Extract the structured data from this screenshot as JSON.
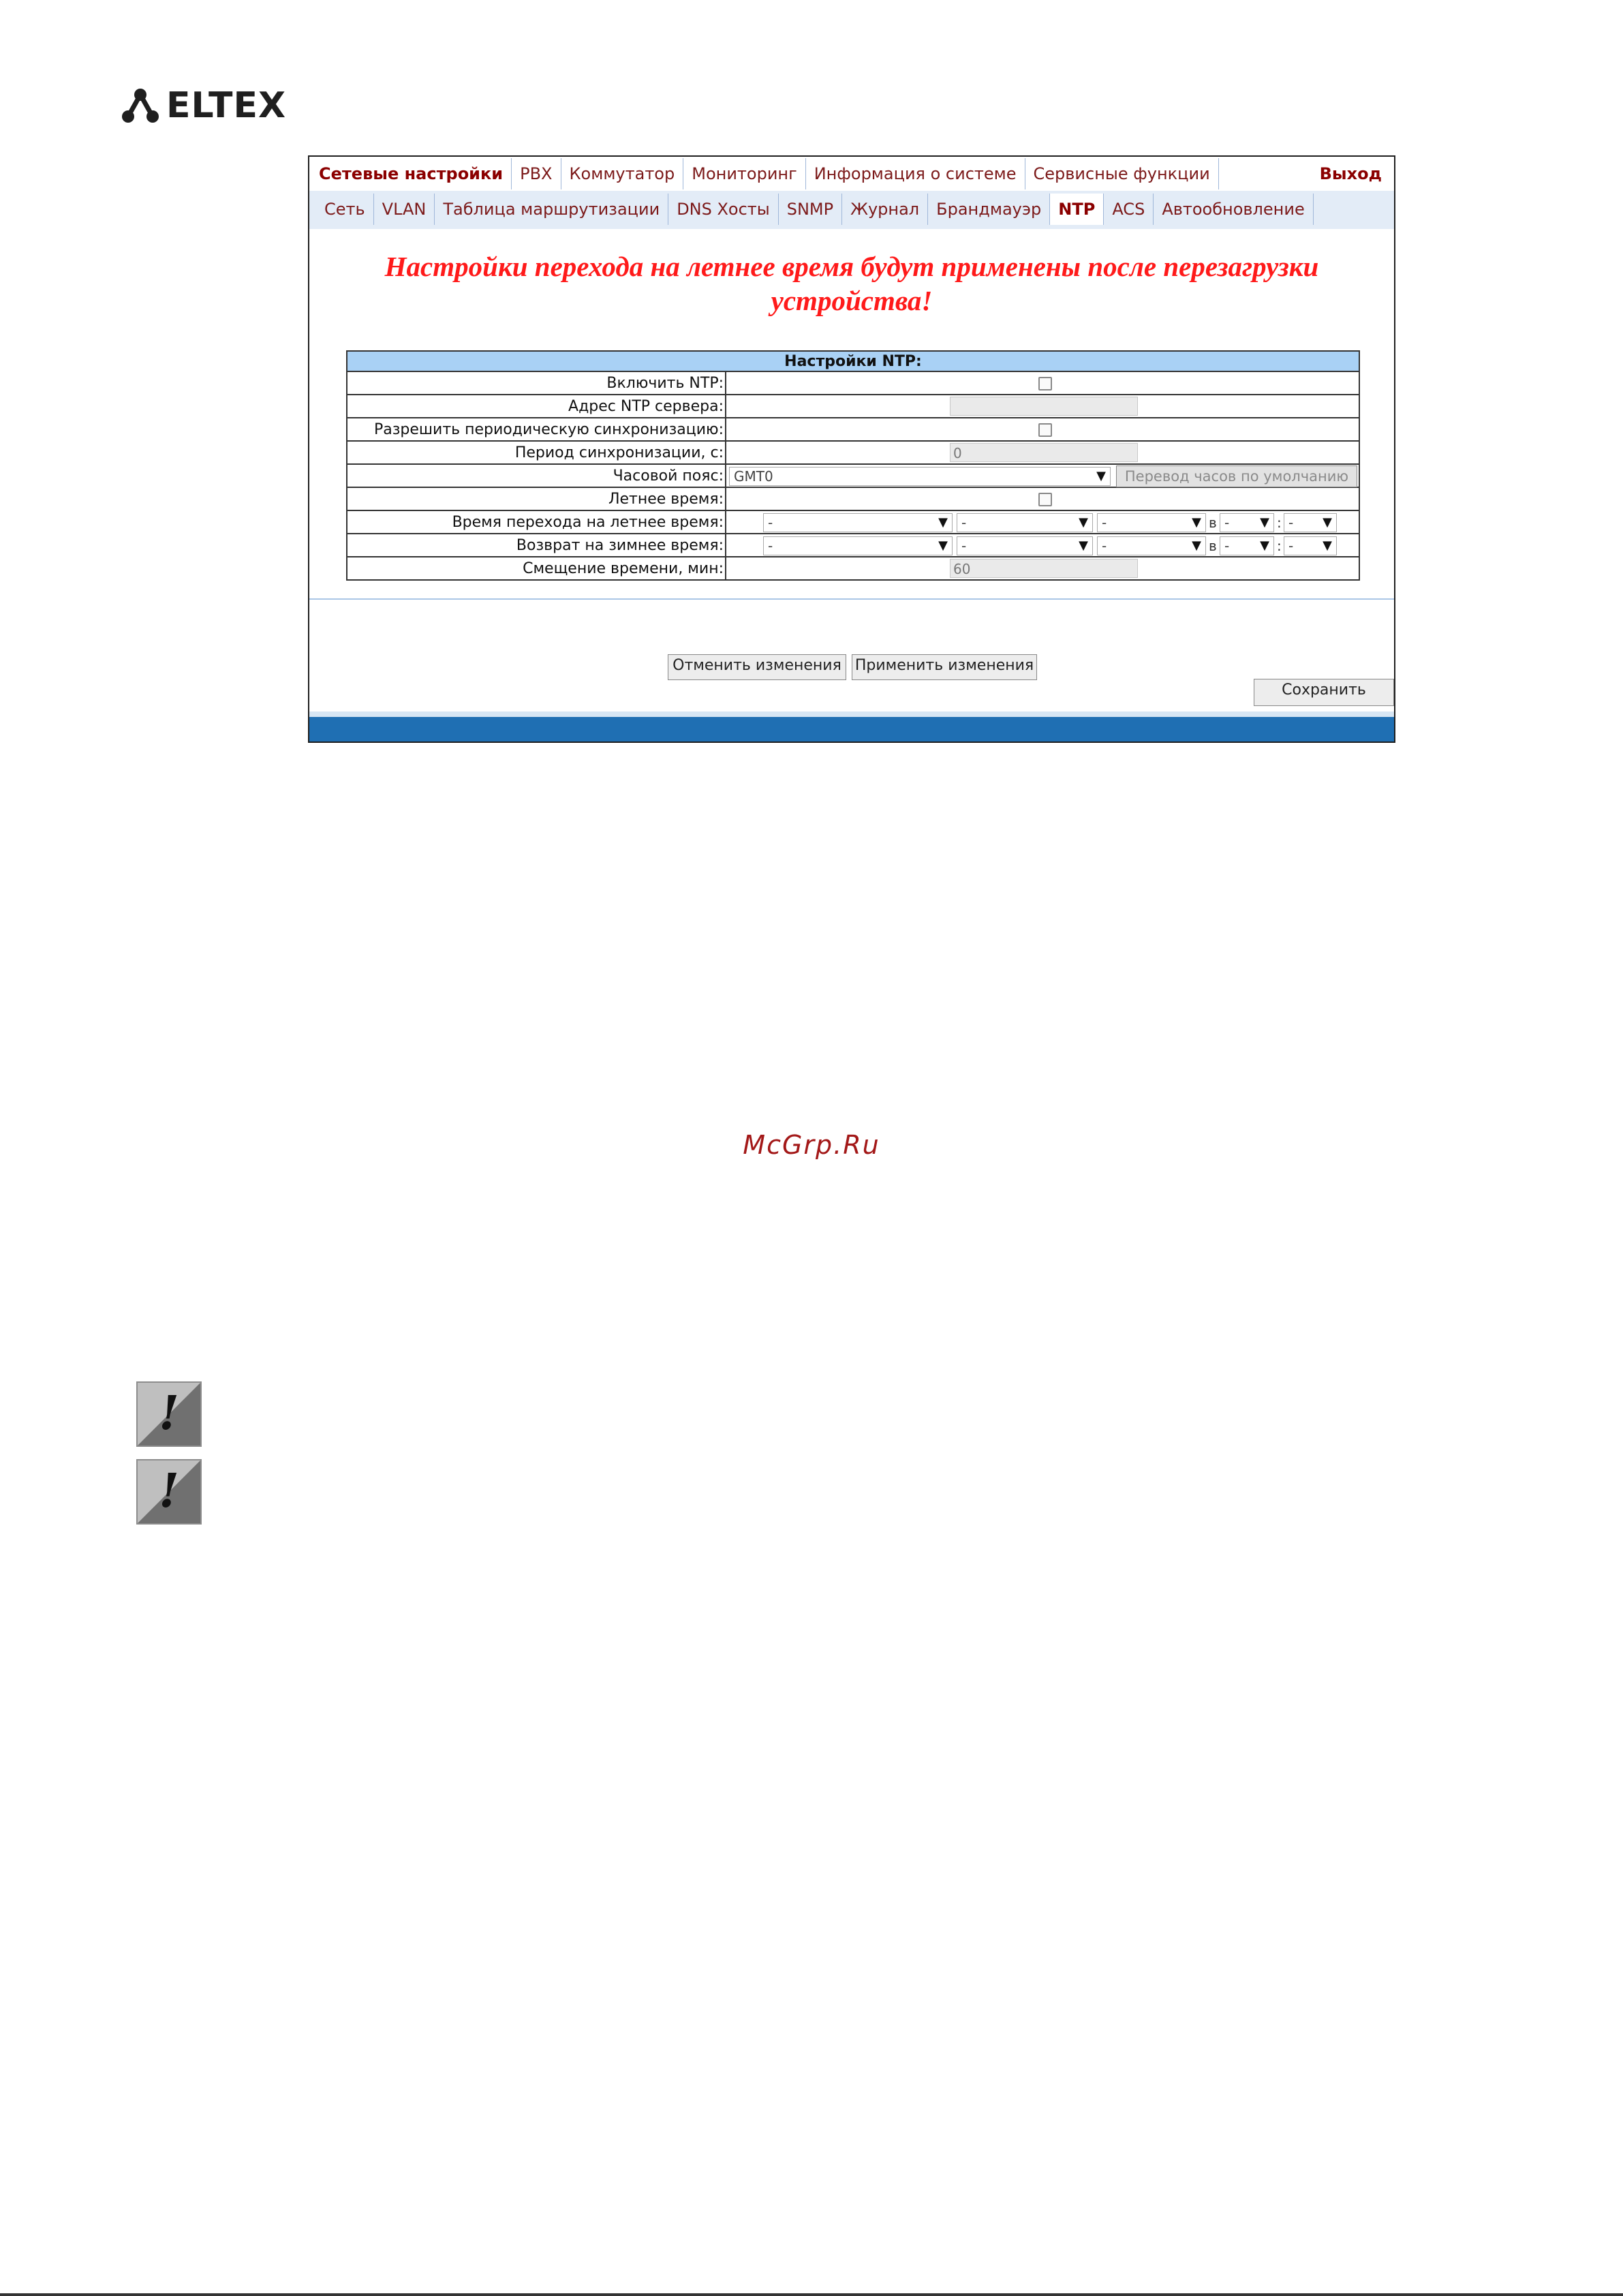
{
  "logo": {
    "text": "ELTEX"
  },
  "topnav": {
    "tabs": [
      "Сетевые настройки",
      "PBX",
      "Коммутатор",
      "Мониторинг",
      "Информация о системе",
      "Сервисные функции"
    ],
    "exit": "Выход"
  },
  "subnav": {
    "tabs": [
      "Сеть",
      "VLAN",
      "Таблица маршрутизации",
      "DNS Хосты",
      "SNMP",
      "Журнал",
      "Брандмауэр",
      "NTP",
      "ACS",
      "Автообновление"
    ]
  },
  "warning": "Настройки перехода на летнее время будут применены после перезагрузки устройства!",
  "ntp": {
    "header": "Настройки NTP:",
    "labels": {
      "enable": "Включить NTP:",
      "server": "Адрес NTP сервера:",
      "periodic": "Разрешить периодическую синхронизацию:",
      "period": "Период синхронизации, с:",
      "timezone": "Часовой пояс:",
      "dst": "Летнее время:",
      "dst_start": "Время перехода на летнее время:",
      "dst_end": "Возврат на зимнее время:",
      "offset": "Смещение времени, мин:"
    },
    "values": {
      "period": "0",
      "timezone": "GMT0",
      "offset": "60",
      "dash": "-",
      "at": "в",
      "colon": ":"
    },
    "tz_default_button": "Перевод часов по умолчанию"
  },
  "buttons": {
    "cancel": "Отменить изменения",
    "apply": "Применить изменения",
    "save": "Сохранить"
  },
  "watermark": "McGrp.Ru",
  "notices": [
    "!",
    "!"
  ]
}
